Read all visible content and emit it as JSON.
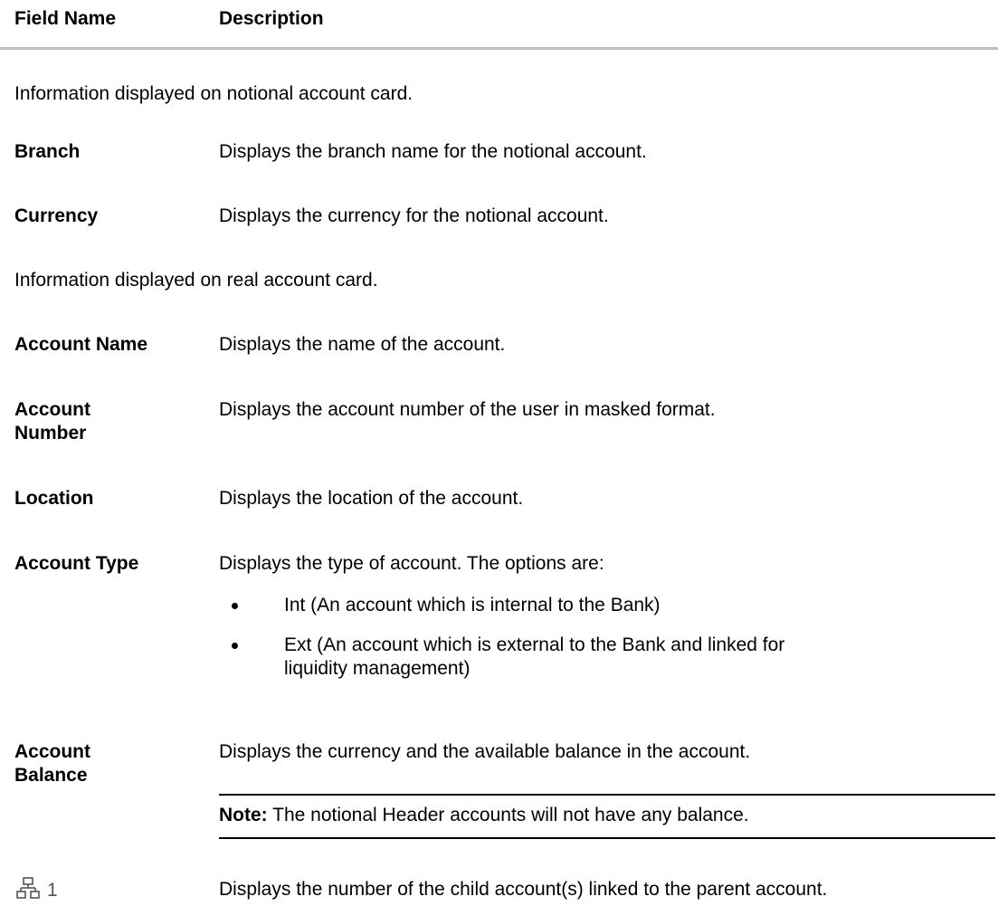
{
  "header": {
    "field_name": "Field Name",
    "description": "Description"
  },
  "sections": {
    "notional": "Information displayed on notional account card.",
    "real": "Information displayed on real account card."
  },
  "rows": [
    {
      "field": "Branch",
      "desc": "Displays the branch name for the notional account."
    },
    {
      "field": "Currency",
      "desc": "Displays the currency for the notional account."
    },
    {
      "field": "Account Name",
      "desc": "Displays the name of the account."
    },
    {
      "field_line1": "Account",
      "field_line2": "Number",
      "desc": "Displays the account number of the user in masked format."
    },
    {
      "field": "Location",
      "desc": "Displays the location of the account."
    },
    {
      "field": "Account Type",
      "desc": "Displays the type of account. The options are:"
    },
    {
      "field_line1": "Account",
      "field_line2": "Balance",
      "desc": "Displays the currency and the available balance in the account."
    }
  ],
  "account_type_options": [
    "Int (An account which is internal to the Bank)",
    "Ext (An account which is external to the Bank and linked for",
    "liquidity management)"
  ],
  "note": {
    "label": "Note:",
    "text": " The notional Header accounts will not have any balance."
  },
  "child_accounts": {
    "icon": "hierarchy-icon",
    "count": "1",
    "desc": "Displays the number of the child account(s) linked to the parent account."
  }
}
